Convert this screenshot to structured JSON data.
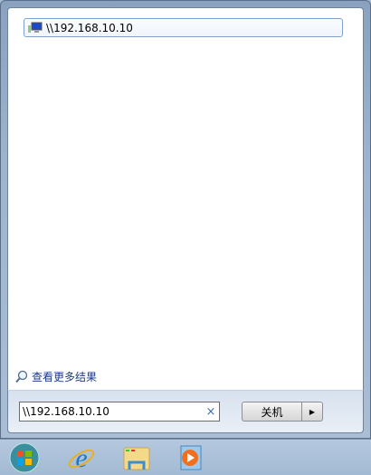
{
  "results": [
    {
      "label": "\\\\192.168.10.10",
      "icon": "network-computer-icon"
    }
  ],
  "see_more": "查看更多结果",
  "search": {
    "value": "\\\\192.168.10.10",
    "clear": "×"
  },
  "shutdown": {
    "label": "关机",
    "arrow": "▶"
  },
  "taskbar": [
    "start",
    "internet-explorer",
    "windows-explorer",
    "media-player"
  ]
}
